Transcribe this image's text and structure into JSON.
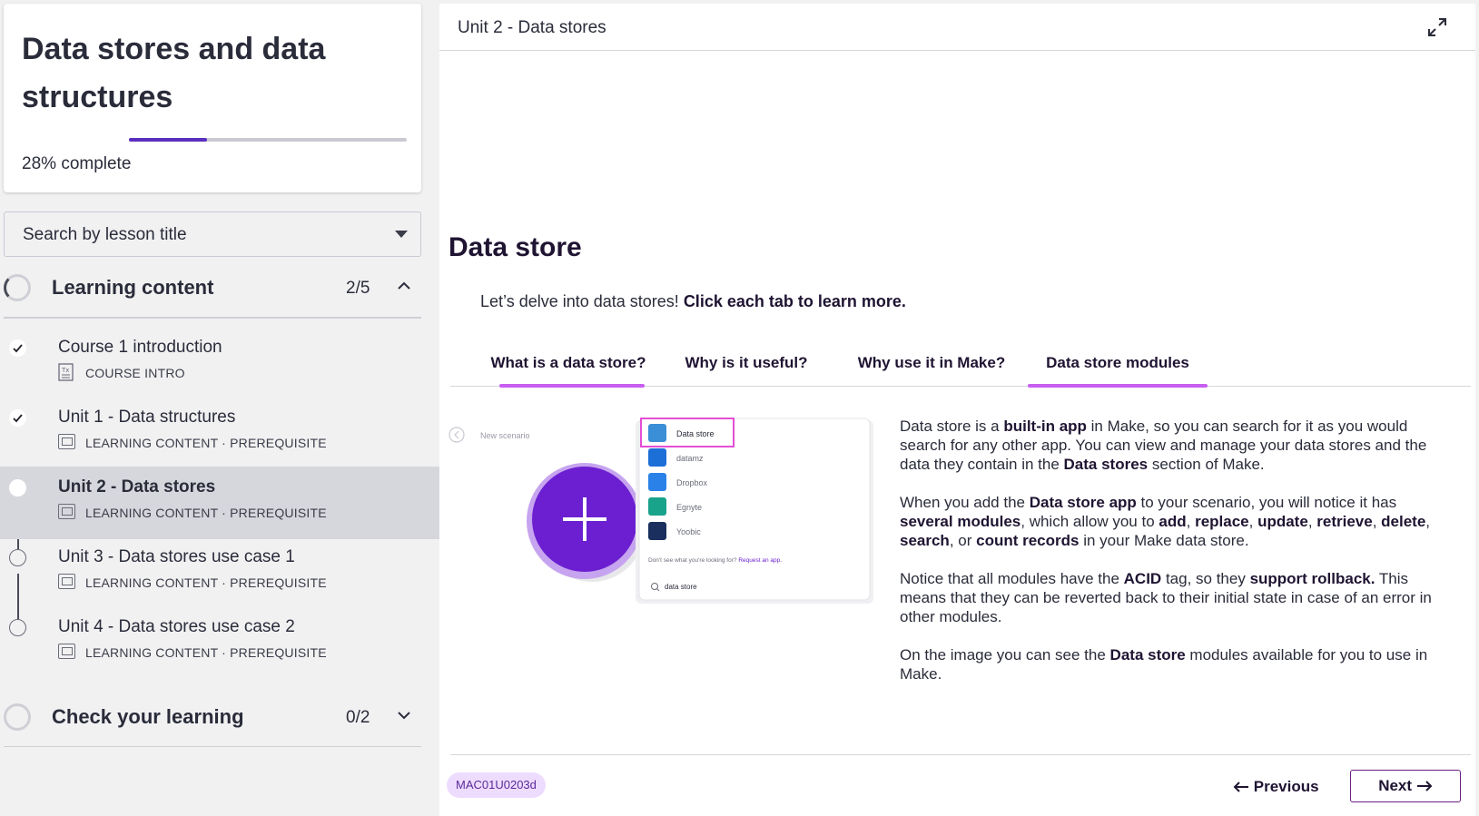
{
  "course": {
    "title": "Data stores and data structures",
    "progress_percent_label": "28%",
    "progress_suffix": "complete",
    "progress_fraction": 0.28
  },
  "search": {
    "placeholder": "Search by lesson title"
  },
  "sections": [
    {
      "title": "Learning content",
      "count": "2/5",
      "expanded": true,
      "lessons": [
        {
          "title": "Course 1 introduction",
          "meta": "COURSE INTRO",
          "status": "done",
          "icon": "document-icon"
        },
        {
          "title": "Unit 1 - Data structures",
          "meta": "LEARNING CONTENT · PREREQUISITE",
          "status": "done",
          "icon": "slides-icon"
        },
        {
          "title": "Unit 2 - Data stores",
          "meta": "LEARNING CONTENT · PREREQUISITE",
          "status": "current",
          "icon": "slides-icon"
        },
        {
          "title": "Unit 3 - Data stores use case 1",
          "meta": "LEARNING CONTENT · PREREQUISITE",
          "status": "todo",
          "icon": "slides-icon"
        },
        {
          "title": "Unit 4 - Data stores use case 2",
          "meta": "LEARNING CONTENT · PREREQUISITE",
          "status": "todo",
          "icon": "slides-icon"
        }
      ]
    },
    {
      "title": "Check your learning",
      "count": "0/2",
      "expanded": false
    }
  ],
  "main": {
    "header_title": "Unit 2 - Data stores",
    "heading": "Data store",
    "intro_plain": "Let’s delve into data stores! ",
    "intro_bold": "Click each tab to learn more.",
    "tabs": [
      {
        "label": "What is a data store?"
      },
      {
        "label": "Why is it useful?"
      },
      {
        "label": "Why use it in Make?"
      },
      {
        "label": "Data store modules"
      }
    ],
    "illustration": {
      "back_label": "New scenario",
      "apps": [
        "Data store",
        "datamz",
        "Dropbox",
        "Egnyte",
        "Yoobic"
      ],
      "hint": "Don't see what you're looking for? ",
      "hint_link": "Request an app.",
      "search_value": "data store"
    },
    "paragraphs": [
      [
        {
          "t": "Data store is a ",
          "b": false
        },
        {
          "t": "built-in app",
          "b": true
        },
        {
          "t": " in Make, so you can search for it as you would search for any other app. You can view and manage your data stores and the data they contain in the ",
          "b": false
        },
        {
          "t": "Data stores",
          "b": true
        },
        {
          "t": " section of Make.",
          "b": false
        }
      ],
      [
        {
          "t": "When you add the ",
          "b": false
        },
        {
          "t": "Data store app",
          "b": true
        },
        {
          "t": " to your scenario, you will notice it has ",
          "b": false
        },
        {
          "t": "several modules",
          "b": true
        },
        {
          "t": ", which allow you to ",
          "b": false
        },
        {
          "t": "add",
          "b": true
        },
        {
          "t": ", ",
          "b": false
        },
        {
          "t": "replace",
          "b": true
        },
        {
          "t": ", ",
          "b": false
        },
        {
          "t": "update",
          "b": true
        },
        {
          "t": ", ",
          "b": false
        },
        {
          "t": "retrieve",
          "b": true
        },
        {
          "t": ", ",
          "b": false
        },
        {
          "t": "delete",
          "b": true
        },
        {
          "t": ", ",
          "b": false
        },
        {
          "t": "search",
          "b": true
        },
        {
          "t": ", or ",
          "b": false
        },
        {
          "t": "count records",
          "b": true
        },
        {
          "t": " in your Make data store.",
          "b": false
        }
      ],
      [
        {
          "t": "Notice that all modules have the ",
          "b": false
        },
        {
          "t": "ACID",
          "b": true
        },
        {
          "t": " tag, so they ",
          "b": false
        },
        {
          "t": "support rollback.",
          "b": true
        },
        {
          "t": " This means that they can be reverted back to their initial state in case of an error in other modules.",
          "b": false
        }
      ],
      [
        {
          "t": "On the image you can see the ",
          "b": false
        },
        {
          "t": "Data store",
          "b": true
        },
        {
          "t": " modules available for you to use in Make.",
          "b": false
        }
      ]
    ],
    "code": "MAC01U0203d",
    "prev_label": "Previous",
    "next_label": "Next"
  },
  "colors": {
    "accent": "#c75ef0",
    "purple": "#6b1fd0",
    "dark": "#1f1432"
  }
}
